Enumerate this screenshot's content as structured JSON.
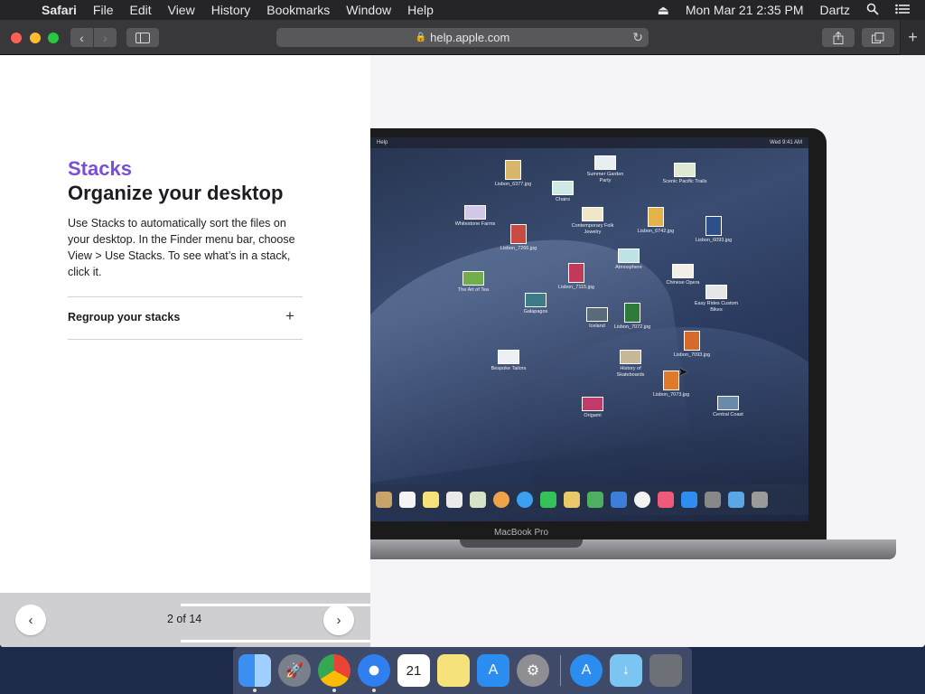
{
  "menubar": {
    "app_name": "Safari",
    "items": [
      "File",
      "Edit",
      "View",
      "History",
      "Bookmarks",
      "Window",
      "Help"
    ],
    "clock": "Mon Mar 21  2:35 PM",
    "user": "Dartz"
  },
  "browser": {
    "url": "help.apple.com"
  },
  "content": {
    "section_title": "Stacks",
    "heading": "Organize your desktop",
    "description": "Use Stacks to automatically sort the files on your desktop. In the Finder menu bar, choose View > Use Stacks. To see what’s in a stack, click it.",
    "accordion_label": "Regroup your stacks"
  },
  "pager": {
    "current": "2 of 14",
    "progress": 0.14
  },
  "illustration": {
    "mini_menubar_left": "Help",
    "mini_clock": "Wed 9:41 AM",
    "laptop_brand": "MacBook Pro",
    "files": [
      "Lisbon_6377.jpg",
      "Chairs",
      "Summer Garden Party",
      "Scenic Pacific Trails",
      "Whitestone Farms",
      "Contemporary Folk Jewelry",
      "Lisbon_6742.jpg",
      "Lisbon_6093.jpg",
      "Lisbon_7266.jpg",
      "Atmosphere",
      "The Art of Tea",
      "Lisbon_7115.jpg",
      "Chinese Opera",
      "Easy Rides Custom Bikes",
      "Galapagos",
      "Iceland",
      "Lisbon_7072.jpg",
      "Lisbon_7093.jpg",
      "Bespoke Tailors",
      "History of Skateboards",
      "Lisbon_7073.jpg",
      "Origami",
      "Central Coast"
    ]
  },
  "colors": {
    "accent": "#7a4fd6"
  }
}
